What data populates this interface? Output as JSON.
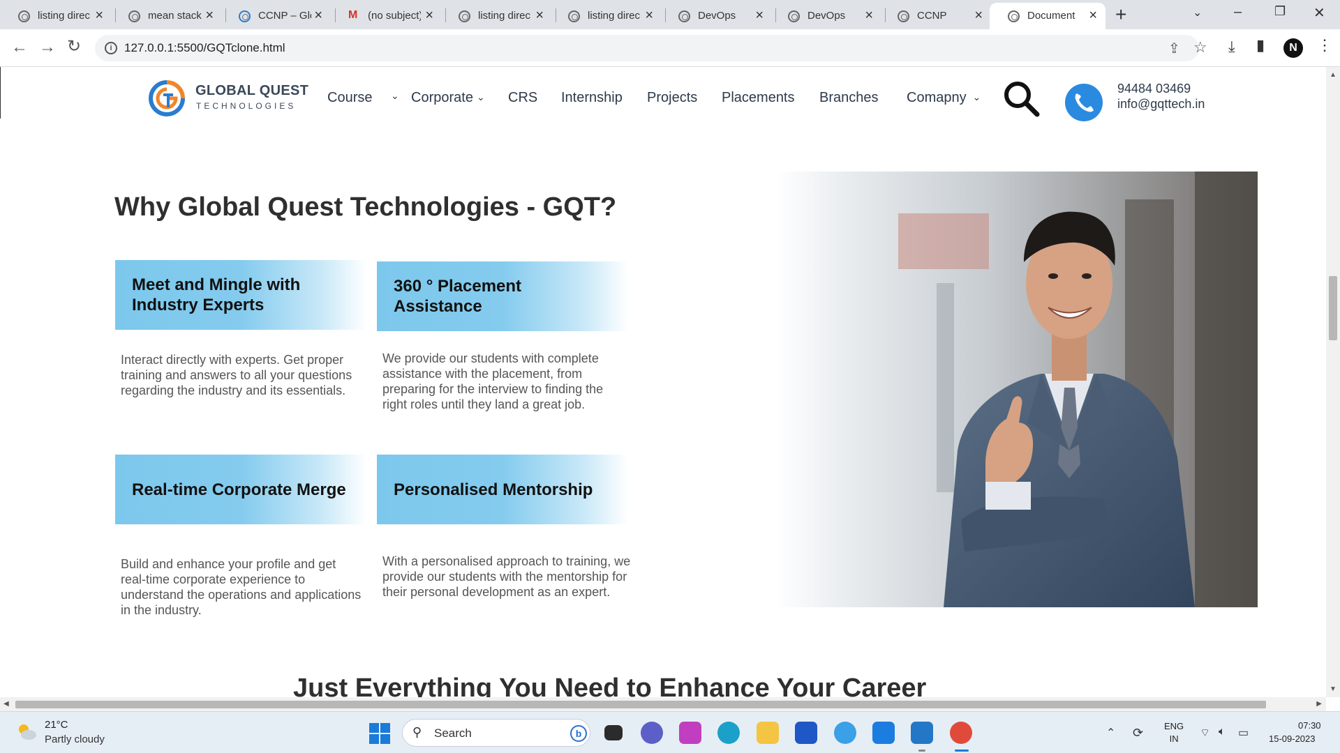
{
  "browser": {
    "tabs": [
      {
        "title": "listing direc",
        "icon": "globe-icon"
      },
      {
        "title": "mean stack",
        "icon": "globe-icon"
      },
      {
        "title": "CCNP – Glo",
        "icon": "gq-icon"
      },
      {
        "title": "(no subject)",
        "icon": "gmail-icon"
      },
      {
        "title": "listing direc",
        "icon": "globe-icon"
      },
      {
        "title": "listing direc",
        "icon": "globe-icon"
      },
      {
        "title": "DevOps",
        "icon": "globe-icon"
      },
      {
        "title": "DevOps",
        "icon": "globe-icon"
      },
      {
        "title": "CCNP",
        "icon": "globe-icon"
      },
      {
        "title": "Document",
        "icon": "globe-icon",
        "active": true
      }
    ],
    "url": "127.0.0.1:5500/GQTclone.html",
    "profile_initial": "N"
  },
  "site": {
    "logo_title": "GLOBAL QUEST",
    "logo_subtitle": "TECHNOLOGIES",
    "nav": [
      "Course",
      "Corporate",
      "CRS",
      "Internship",
      "Projects",
      "Placements",
      "Branches",
      "Comapny"
    ],
    "phone": "94484 03469",
    "email": "info@gqttech.in"
  },
  "why": {
    "heading": "Why Global Quest Technologies - GQT?",
    "features": [
      {
        "title": "Meet and Mingle with Industry Experts",
        "desc": "Interact directly with experts. Get proper training and answers to all your questions regarding the industry and its essentials."
      },
      {
        "title": "360 ° Placement Assistance",
        "desc": "We provide our students with complete assistance with the placement, from preparing for the interview to finding the right roles until they land a great job."
      },
      {
        "title": "Real-time Corporate Merge",
        "desc": "Build and enhance your profile and get real-time corporate experience to understand the operations and applications in the industry."
      },
      {
        "title": "Personalised Mentorship",
        "desc": "With a personalised approach to training, we provide our students with the mentorship for their personal development as an expert."
      }
    ]
  },
  "next_section": {
    "heading": "Just Everything You Need to Enhance Your Career"
  },
  "taskbar": {
    "weather_temp": "21°C",
    "weather_desc": "Partly cloudy",
    "search_label": "Search",
    "lang_line1": "ENG",
    "lang_line2": "IN",
    "time": "07:30",
    "date": "15-09-2023"
  },
  "colors": {
    "feature_box": "#7cc8ec",
    "phone_circle": "#2a8ae0",
    "logo_orange": "#f0862a",
    "logo_blue": "#2a7ccf"
  }
}
